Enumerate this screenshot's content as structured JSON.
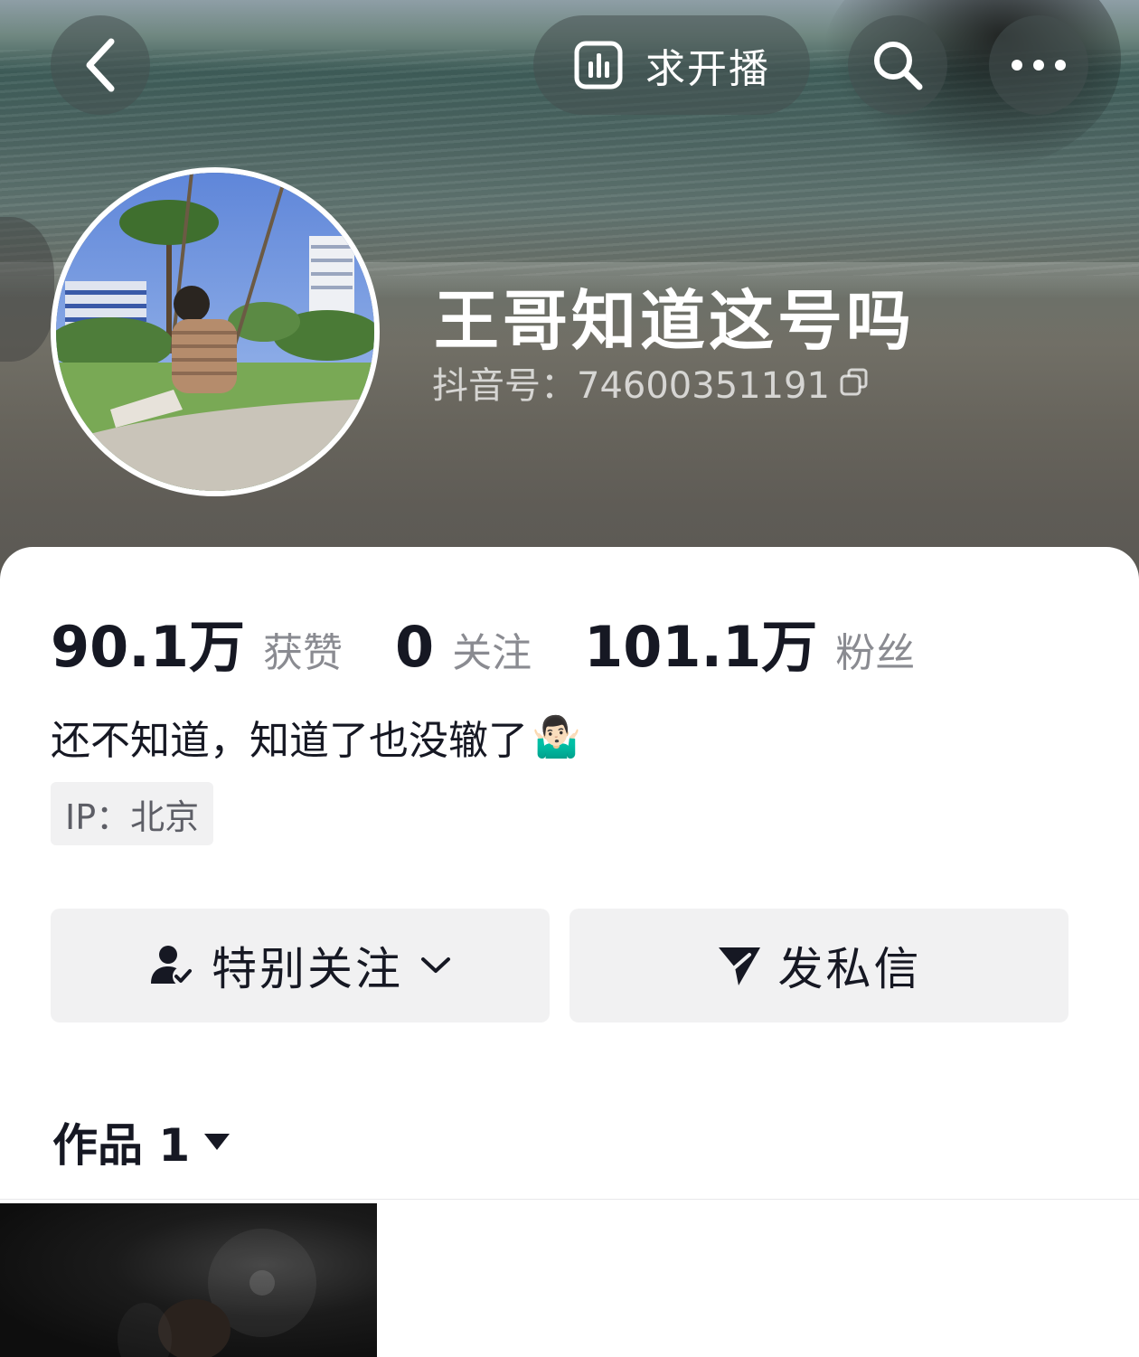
{
  "header": {
    "live_request_label": "求开播",
    "icons": {
      "back": "chevron-left-icon",
      "live_chart": "live-chart-icon",
      "search": "search-icon",
      "more": "more-dots-icon"
    }
  },
  "profile": {
    "nickname": "王哥知道这号吗",
    "douyin_id": "抖音号：74600351191",
    "copy_icon": "copy-icon"
  },
  "stats": [
    {
      "value": "90.1万",
      "label": "获赞"
    },
    {
      "value": "0",
      "label": "关注"
    },
    {
      "value": "101.1万",
      "label": "粉丝"
    }
  ],
  "bio": {
    "text": "还不知道，知道了也没辙了",
    "emoji": "🤷🏻‍♂️"
  },
  "ip_location": "IP：北京",
  "actions": {
    "follow_label": "特别关注",
    "message_label": "发私信"
  },
  "tabs": {
    "works_label": "作品 1"
  },
  "colors": {
    "primary_text": "#161823",
    "secondary_text": "#8a8b91",
    "button_bg": "#f1f1f2"
  }
}
